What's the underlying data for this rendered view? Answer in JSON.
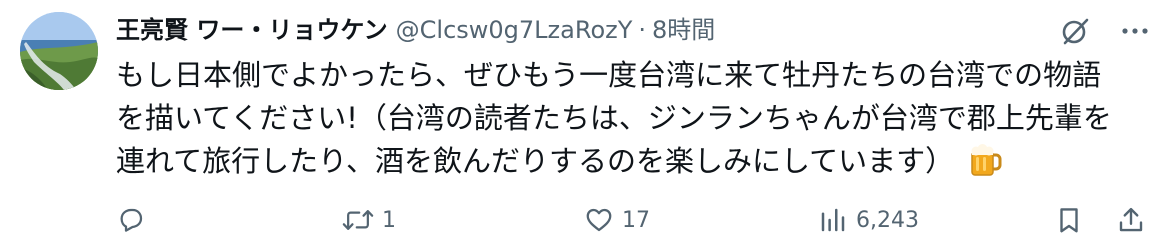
{
  "tweet": {
    "author": {
      "display_name": "王亮賢 ワー・リョウケン",
      "handle": "@Clcsw0g7LzaRozY",
      "separator": "·",
      "timestamp": "8時間"
    },
    "text": "もし日本側でよかったら、ぜひもう一度台湾に来て牡丹たちの台湾での物語\nを描いてください!（台湾の読者たちは、ジンランちゃんが台湾で郡上先輩を\n連れて旅行したり、酒を飲んだりするのを楽しみにしています）",
    "emoji": "beer-mug-icon",
    "actions": {
      "reply_count": "",
      "repost_count": "1",
      "like_count": "17",
      "view_count": "6,243"
    }
  },
  "icons": {
    "avatar": "coastline-landscape-photo",
    "grok": "grok-icon",
    "more": "more-icon",
    "reply": "reply-icon",
    "repost": "repost-icon",
    "like": "heart-icon",
    "views": "views-icon",
    "bookmark": "bookmark-icon",
    "share": "share-icon"
  },
  "colors": {
    "text_primary": "#0f1419",
    "text_secondary": "#536471",
    "background": "#ffffff"
  }
}
